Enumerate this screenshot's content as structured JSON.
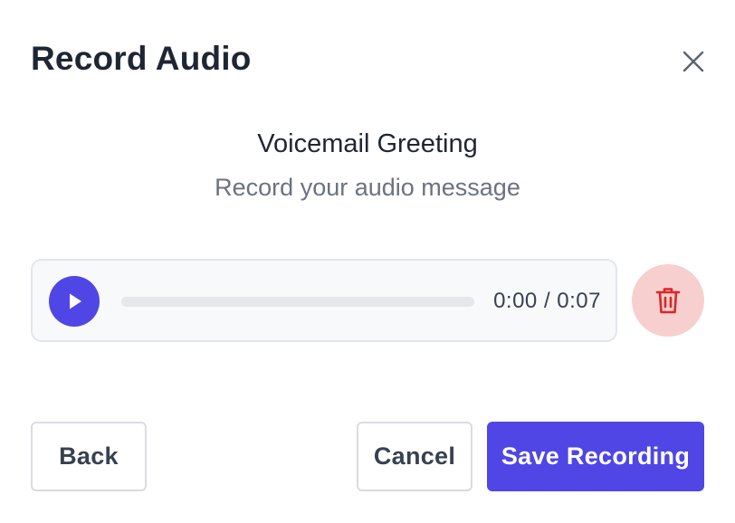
{
  "dialog": {
    "title": "Record Audio",
    "close_icon": "close-icon"
  },
  "recording": {
    "heading": "Voicemail Greeting",
    "subheading": "Record your audio message"
  },
  "player": {
    "play_icon": "play-icon",
    "progress": 0,
    "time_display": "0:00 / 0:07",
    "accent_color": "#4f46e5"
  },
  "delete": {
    "icon": "trash-icon",
    "color": "#dc2626",
    "background": "#f7cfcf"
  },
  "footer": {
    "back_label": "Back",
    "cancel_label": "Cancel",
    "save_label": "Save Recording"
  }
}
